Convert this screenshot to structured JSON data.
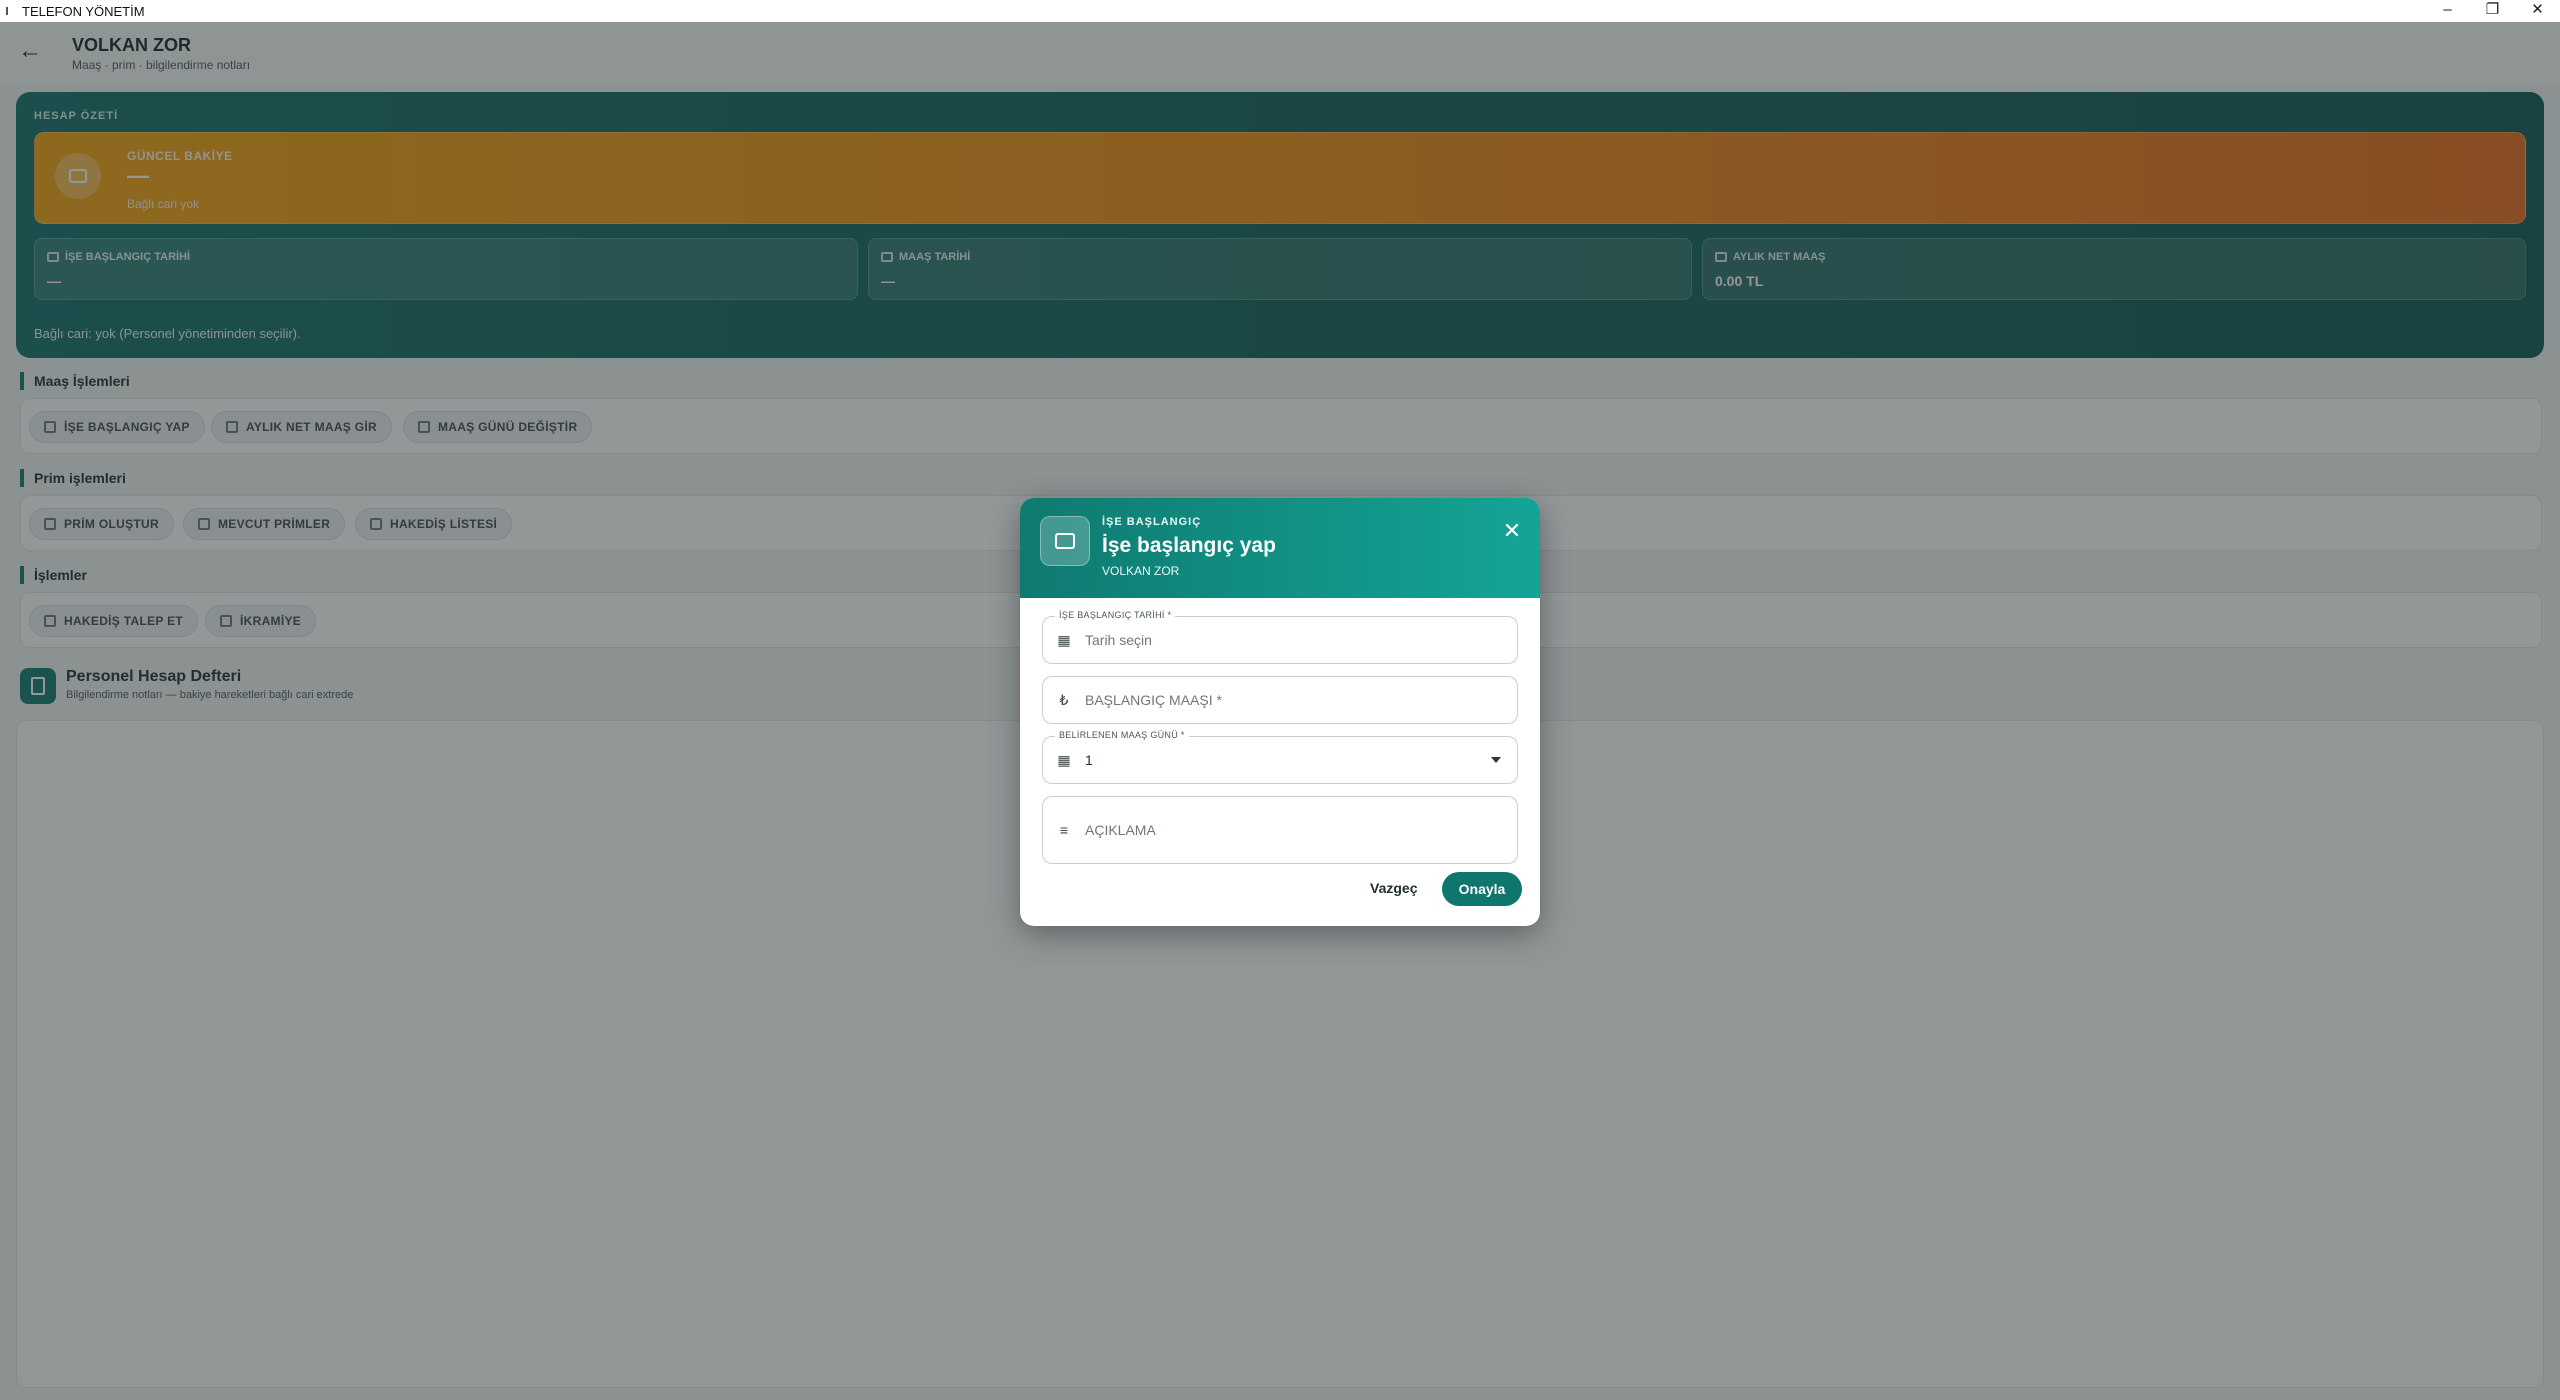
{
  "window": {
    "title": "TELEFON YÖNETİM",
    "controls": [
      "–",
      "❐",
      "✕"
    ]
  },
  "header": {
    "name": "VOLKAN ZOR",
    "subtitle": "Maaş · prim · bilgilendirme notları"
  },
  "summary": {
    "section_title": "HESAP ÖZETİ",
    "balance_label": "GÜNCEL BAKİYE",
    "balance_value": "—",
    "balance_note": "Bağlı cari yok",
    "cards": [
      {
        "label": "İŞE BAŞLANGIÇ TARİHİ",
        "value": "—"
      },
      {
        "label": "MAAŞ TARİHİ",
        "value": "—"
      },
      {
        "label": "AYLIK NET MAAŞ",
        "value": "0.00 TL"
      }
    ],
    "linked_note": "Bağlı cari: yok (Personel yönetiminden seçilir)."
  },
  "sections": {
    "salary": {
      "title": "Maaş İşlemleri",
      "buttons": [
        "İŞE BAŞLANGIÇ YAP",
        "AYLIK NET MAAŞ GİR",
        "MAAŞ GÜNÜ DEĞİŞTİR"
      ]
    },
    "bonus": {
      "title": "Prim işlemleri",
      "buttons": [
        "PRİM OLUŞTUR",
        "MEVCUT PRİMLER",
        "HAKEDİŞ LİSTESİ"
      ]
    },
    "ops": {
      "title": "İşlemler",
      "buttons": [
        "HAKEDİŞ TALEP ET",
        "İKRAMİYE"
      ]
    }
  },
  "ledger": {
    "title": "Personel Hesap Defteri",
    "subtitle": "Bilgilendirme notları — bakiye hareketleri bağlı cari extrede"
  },
  "dialog": {
    "eyebrow": "İŞE BAŞLANGIÇ",
    "title": "İşe başlangıç yap",
    "subtitle": "VOLKAN ZOR",
    "close_icon": "✕",
    "fields": {
      "start_date": {
        "label": "İŞE BAŞLANGIÇ TARİHİ *",
        "placeholder": "Tarih seçin"
      },
      "start_salary": {
        "placeholder": "BAŞLANGIÇ MAAŞI *",
        "icon": "₺"
      },
      "pay_day": {
        "label": "BELİRLENEN MAAŞ GÜNÜ *",
        "value": "1"
      },
      "description": {
        "placeholder": "AÇIKLAMA"
      }
    },
    "cancel_label": "Vazgeç",
    "confirm_label": "Onayla"
  },
  "colors": {
    "accent": "#0f766e",
    "balance_start": "#f3a20a",
    "balance_end": "#ea6b18"
  }
}
